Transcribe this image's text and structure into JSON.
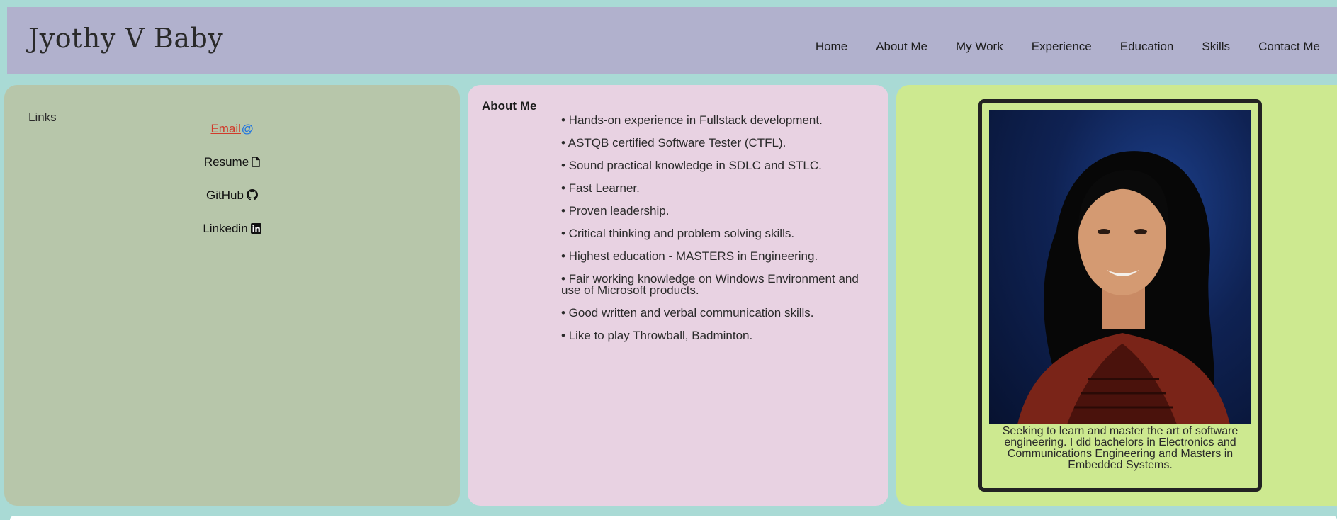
{
  "header": {
    "title": "Jyothy V Baby",
    "nav": [
      "Home",
      "About Me",
      "My Work",
      "Experience",
      "Education",
      "Skills",
      "Contact Me"
    ]
  },
  "links": {
    "heading": "Links",
    "email": "Email",
    "email_icon": "@",
    "resume": "Resume",
    "github": "GitHub",
    "linkedin": "Linkedin",
    "icons": [
      "at-icon",
      "file-icon",
      "github-icon",
      "linkedin-icon"
    ]
  },
  "about": {
    "heading": "About Me",
    "items": [
      "• Hands-on experience in Fullstack development.",
      "• ASTQB certified Software Tester (CTFL).",
      "• Sound practical knowledge in SDLC and STLC.",
      "• Fast Learner.",
      "• Proven leadership.",
      "• Critical thinking and problem solving skills.",
      "• Highest education - MASTERS in Engineering.",
      "• Fair working knowledge on Windows Environment and use of Microsoft products.",
      "• Good written and verbal communication skills.",
      "• Like to play Throwball, Badminton."
    ]
  },
  "profile": {
    "caption": "Seeking to learn and master the art of software engineering. I did bachelors in Electronics and Communications Engineering and Masters in Embedded Systems."
  },
  "colors": {
    "background": "#a9dad5",
    "header": "#b1b1cd",
    "links_panel": "#b7c6aa",
    "about_panel": "#e8d2e2",
    "photo_panel": "#cde990",
    "email_link": "#d13a2a",
    "at_icon": "#1f74e0"
  }
}
